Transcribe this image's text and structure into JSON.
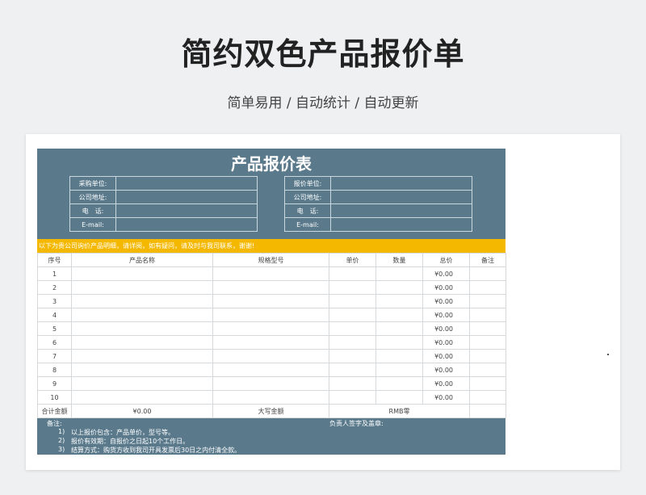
{
  "page": {
    "title": "简约双色产品报价单",
    "subtitle": "简单易用 / 自动统计 / 自动更新"
  },
  "sheet": {
    "title": "产品报价表",
    "left_labels": [
      "采购单位:",
      "公司地址:",
      "电　话:",
      "E-mail:"
    ],
    "right_labels": [
      "报价单位:",
      "公司地址:",
      "电　话:",
      "E-mail:"
    ],
    "notice": "以下为贵公司询价产品明细，请详阅，如有疑问，请及时与我司联系，谢谢!",
    "columns": [
      "序号",
      "产品名称",
      "规格型号",
      "单价",
      "数量",
      "总价",
      "备注"
    ],
    "rows": [
      {
        "no": "1",
        "total": "¥0.00"
      },
      {
        "no": "2",
        "total": "¥0.00"
      },
      {
        "no": "3",
        "total": "¥0.00"
      },
      {
        "no": "4",
        "total": "¥0.00"
      },
      {
        "no": "5",
        "total": "¥0.00"
      },
      {
        "no": "6",
        "total": "¥0.00"
      },
      {
        "no": "7",
        "total": "¥0.00"
      },
      {
        "no": "8",
        "total": "¥0.00"
      },
      {
        "no": "9",
        "total": "¥0.00"
      },
      {
        "no": "10",
        "total": "¥0.00"
      }
    ],
    "summary": {
      "total_label": "合计金额",
      "total_value": "¥0.00",
      "uppercase_label": "大写金额",
      "uppercase_value": "RMB零"
    },
    "footer": {
      "remark_label": "备注:",
      "signature_label": "负责人签字及盖章:",
      "notes": [
        {
          "num": "1)",
          "text": "以上报价包含：产品单价，型号等。"
        },
        {
          "num": "2)",
          "text": "报价有效期：自报价之日起10个工作日。"
        },
        {
          "num": "3)",
          "text": "结算方式：购货方收到我司开具发票后30日之内付清全款。"
        }
      ]
    }
  },
  "colors": {
    "header_bg": "#5a7a8c",
    "notice_bg": "#f5b800"
  }
}
